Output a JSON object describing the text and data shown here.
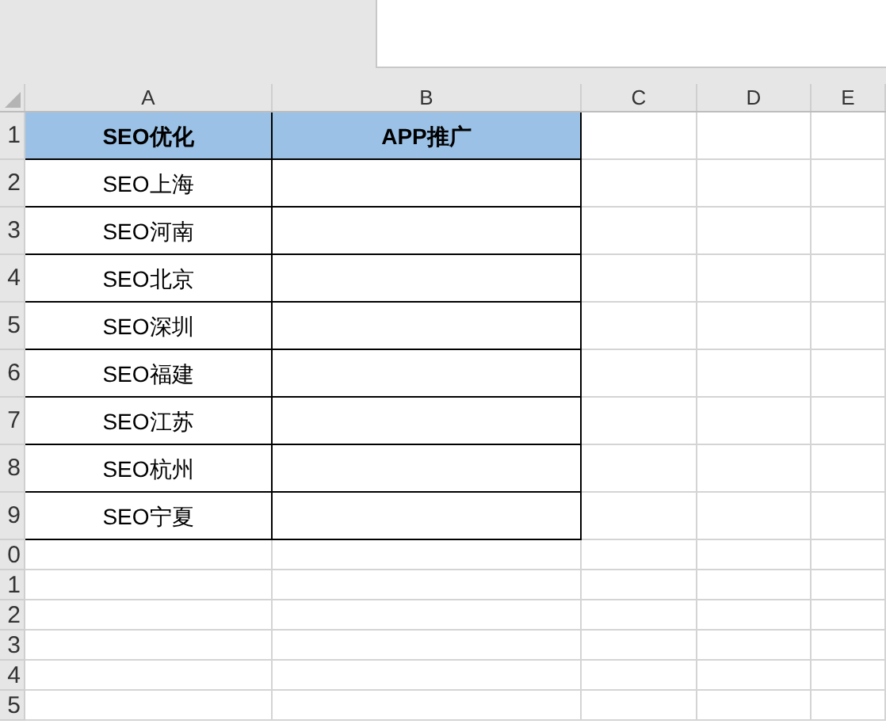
{
  "columns": [
    "A",
    "B",
    "C",
    "D",
    "E"
  ],
  "rows": [
    {
      "number": "1",
      "kind": "header",
      "cells": [
        "SEO优化",
        "APP推广"
      ]
    },
    {
      "number": "2",
      "kind": "data",
      "cells": [
        "SEO上海"
      ]
    },
    {
      "number": "3",
      "kind": "data",
      "cells": [
        "SEO河南"
      ]
    },
    {
      "number": "4",
      "kind": "data",
      "cells": [
        "SEO北京"
      ]
    },
    {
      "number": "5",
      "kind": "data",
      "cells": [
        "SEO深圳"
      ]
    },
    {
      "number": "6",
      "kind": "data",
      "cells": [
        "SEO福建"
      ]
    },
    {
      "number": "7",
      "kind": "data",
      "cells": [
        "SEO江苏"
      ]
    },
    {
      "number": "8",
      "kind": "data",
      "cells": [
        "SEO杭州"
      ]
    },
    {
      "number": "9",
      "kind": "data",
      "cells": [
        "SEO宁夏"
      ]
    },
    {
      "number": "0",
      "kind": "blank"
    },
    {
      "number": "1",
      "kind": "blank"
    },
    {
      "number": "2",
      "kind": "blank"
    },
    {
      "number": "3",
      "kind": "blank"
    },
    {
      "number": "4",
      "kind": "blank"
    },
    {
      "number": "5",
      "kind": "blank"
    }
  ]
}
